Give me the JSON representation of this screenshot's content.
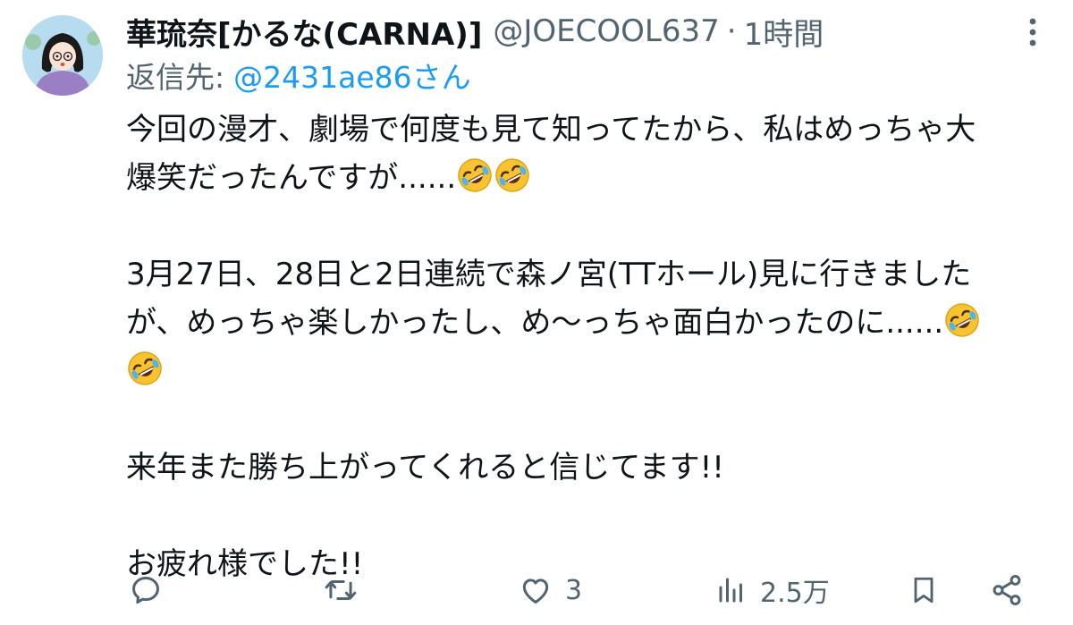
{
  "author": {
    "display_name": "華琉奈[かるな(CARNA)]",
    "handle": "@JOECOOL637",
    "separator": "·",
    "time_ago": "1時間",
    "avatar_icon": "avatar-icon"
  },
  "reply": {
    "prefix": "返信先:",
    "mention": "@2431ae86さん"
  },
  "tweet": {
    "p1_line1": "今回の漫才、劇場で何度も見て知ってたから、私はめっちゃ大",
    "p1_line2": "爆笑だったんですが......",
    "p2_line1": "3月27日、28日と2日連続で森ノ宮(TTホール)見に行きました",
    "p2_line2": "が、めっちゃ楽しかったし、め〜っちゃ面白かったのに......",
    "p3": "来年また勝ち上がってくれると信じてます!!",
    "p4": "お疲れ様でした!!",
    "emoji_name": "rolling-on-the-floor-laughing-emoji"
  },
  "actions": {
    "reply_count": "",
    "retweet_count": "",
    "like_count": "3",
    "views_count": "2.5万"
  },
  "colors": {
    "text": "#0f1419",
    "secondary": "#536471",
    "link": "#1d9bf0",
    "emoji_yellow": "#f7c331"
  }
}
